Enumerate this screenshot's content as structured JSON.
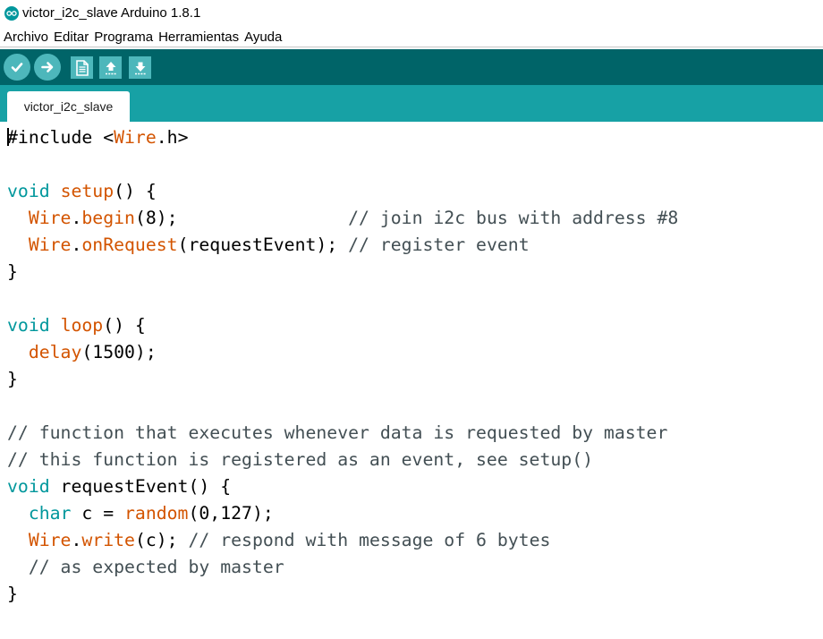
{
  "window": {
    "title": "victor_i2c_slave Arduino 1.8.1",
    "icon": "arduino-logo-icon",
    "accent_color": "#00979d"
  },
  "menu": [
    "Archivo",
    "Editar",
    "Programa",
    "Herramientas",
    "Ayuda"
  ],
  "toolbar": {
    "buttons": [
      "verify-icon",
      "upload-icon",
      "new-icon",
      "open-icon",
      "save-icon"
    ],
    "background_color": "#006468",
    "button_color": "#4db7bb"
  },
  "tabs": {
    "active": "victor_i2c_slave",
    "background_color": "#17a1a5"
  },
  "editor": {
    "colors": {
      "keyword": "#00979c",
      "function": "#d35400",
      "comment": "#434f54",
      "text": "#000000"
    },
    "lines": [
      [
        {
          "t": "#include ",
          "c": "txt"
        },
        {
          "t": "<",
          "c": "txt"
        },
        {
          "t": "Wire",
          "c": "fn"
        },
        {
          "t": ".h>",
          "c": "txt"
        }
      ],
      [],
      [
        {
          "t": "void",
          "c": "kw"
        },
        {
          "t": " ",
          "c": "txt"
        },
        {
          "t": "setup",
          "c": "fn"
        },
        {
          "t": "() {",
          "c": "txt"
        }
      ],
      [
        {
          "t": "  ",
          "c": "txt"
        },
        {
          "t": "Wire",
          "c": "fn"
        },
        {
          "t": ".",
          "c": "txt"
        },
        {
          "t": "begin",
          "c": "fn"
        },
        {
          "t": "(8);                ",
          "c": "txt"
        },
        {
          "t": "// join i2c bus with address #8",
          "c": "cm"
        }
      ],
      [
        {
          "t": "  ",
          "c": "txt"
        },
        {
          "t": "Wire",
          "c": "fn"
        },
        {
          "t": ".",
          "c": "txt"
        },
        {
          "t": "onRequest",
          "c": "fn"
        },
        {
          "t": "(requestEvent); ",
          "c": "txt"
        },
        {
          "t": "// register event",
          "c": "cm"
        }
      ],
      [
        {
          "t": "}",
          "c": "txt"
        }
      ],
      [],
      [
        {
          "t": "void",
          "c": "kw"
        },
        {
          "t": " ",
          "c": "txt"
        },
        {
          "t": "loop",
          "c": "fn"
        },
        {
          "t": "() {",
          "c": "txt"
        }
      ],
      [
        {
          "t": "  ",
          "c": "txt"
        },
        {
          "t": "delay",
          "c": "fn"
        },
        {
          "t": "(1500);",
          "c": "txt"
        }
      ],
      [
        {
          "t": "}",
          "c": "txt"
        }
      ],
      [],
      [
        {
          "t": "// function that executes whenever data is requested by master",
          "c": "cm"
        }
      ],
      [
        {
          "t": "// this function is registered as an event, see setup()",
          "c": "cm"
        }
      ],
      [
        {
          "t": "void",
          "c": "kw"
        },
        {
          "t": " requestEvent() {",
          "c": "txt"
        }
      ],
      [
        {
          "t": "  ",
          "c": "txt"
        },
        {
          "t": "char",
          "c": "kw"
        },
        {
          "t": " c = ",
          "c": "txt"
        },
        {
          "t": "random",
          "c": "fn"
        },
        {
          "t": "(0,127);",
          "c": "txt"
        }
      ],
      [
        {
          "t": "  ",
          "c": "txt"
        },
        {
          "t": "Wire",
          "c": "fn"
        },
        {
          "t": ".",
          "c": "txt"
        },
        {
          "t": "write",
          "c": "fn"
        },
        {
          "t": "(c); ",
          "c": "txt"
        },
        {
          "t": "// respond with message of 6 bytes",
          "c": "cm"
        }
      ],
      [
        {
          "t": "  ",
          "c": "txt"
        },
        {
          "t": "// as expected by master",
          "c": "cm"
        }
      ],
      [
        {
          "t": "}",
          "c": "txt"
        }
      ]
    ]
  }
}
